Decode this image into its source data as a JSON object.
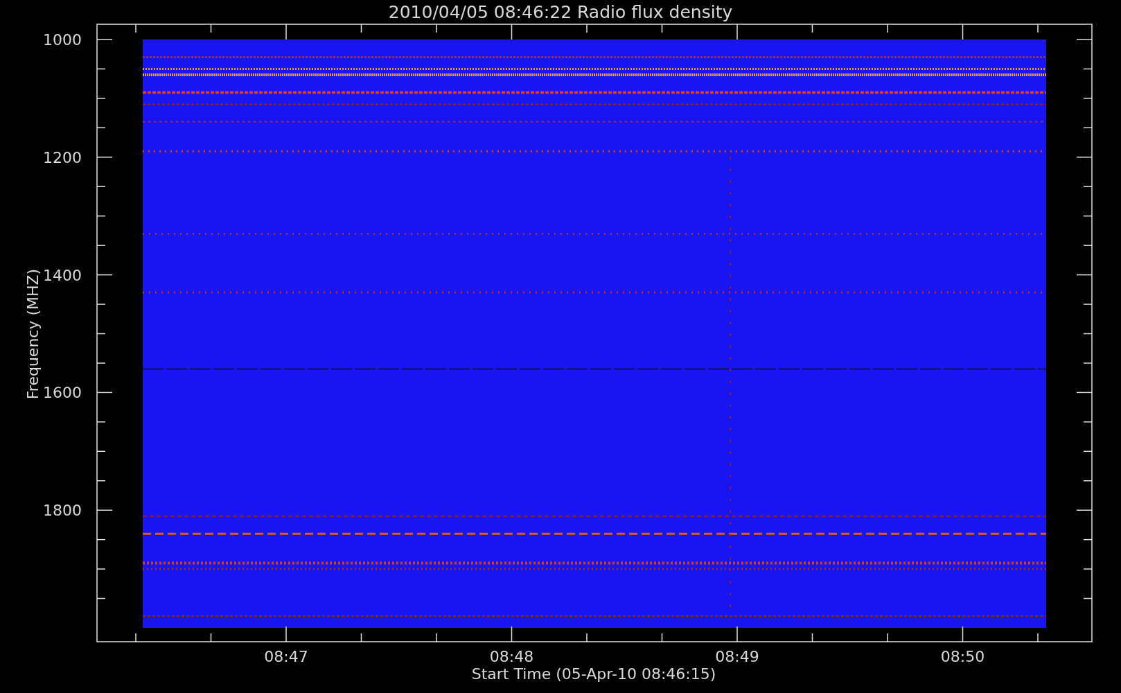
{
  "plot": {
    "title": "2010/04/05 08:46:22 Radio flux density",
    "ylabel": "Frequency (MHZ)",
    "xlabel": "Start Time (05-Apr-10 08:46:15)",
    "yticks": [
      "1000",
      "1200",
      "1400",
      "1600",
      "1800"
    ],
    "xticks": [
      "08:47",
      "08:48",
      "08:49",
      "08:50"
    ]
  }
}
